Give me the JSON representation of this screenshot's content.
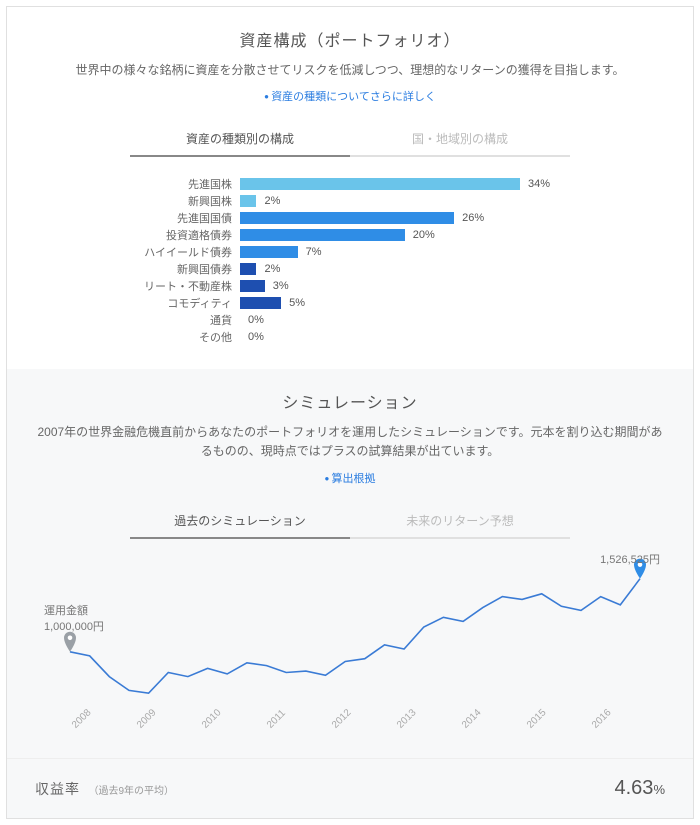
{
  "portfolio": {
    "title": "資産構成（ポートフォリオ）",
    "desc": "世界中の様々な銘柄に資産を分散させてリスクを低減しつつ、理想的なリターンの獲得を目指します。",
    "link": "資産の種類についてさらに詳しく",
    "tab_active": "資産の種類別の構成",
    "tab_inactive": "国・地域別の構成"
  },
  "chart_data": {
    "type": "bar",
    "categories": [
      "先進国株",
      "新興国株",
      "先進国国債",
      "投資適格債券",
      "ハイイールド債券",
      "新興国債券",
      "リート・不動産株",
      "コモディティ",
      "通貨",
      "その他"
    ],
    "values": [
      34,
      2,
      26,
      20,
      7,
      2,
      3,
      5,
      0,
      0
    ],
    "colors": [
      "#6ac4ea",
      "#6ac4ea",
      "#2f8de6",
      "#2f8de6",
      "#2f8de6",
      "#1e4fb0",
      "#1e4fb0",
      "#1e4fb0",
      "#1e4fb0",
      "#1e4fb0"
    ],
    "max": 34,
    "ylabel": "%"
  },
  "sim": {
    "title": "シミュレーション",
    "desc": "2007年の世界金融危機直前からあなたのポートフォリオを運用したシミュレーションです。元本を割り込む期間があるものの、現時点ではプラスの試算結果が出ています。",
    "link": "算出根拠",
    "tab_active": "過去のシミュレーション",
    "tab_inactive": "未来のリターン予想",
    "start_label": "運用金額",
    "start_value": "1,000,000円",
    "end_value": "1,526,525円"
  },
  "line_data": {
    "type": "line",
    "x_ticks": [
      "2008",
      "2009",
      "2010",
      "2011",
      "2012",
      "2013",
      "2014",
      "2015",
      "2016"
    ],
    "start": 1000000,
    "end": 1526525,
    "series_norm": [
      1.0,
      0.97,
      0.82,
      0.72,
      0.7,
      0.85,
      0.82,
      0.88,
      0.84,
      0.92,
      0.9,
      0.85,
      0.86,
      0.83,
      0.93,
      0.95,
      1.05,
      1.02,
      1.18,
      1.25,
      1.22,
      1.32,
      1.4,
      1.38,
      1.42,
      1.33,
      1.3,
      1.4,
      1.34,
      1.53
    ]
  },
  "ret": {
    "label": "収益率",
    "sub": "（過去9年の平均）",
    "value": "4.63",
    "pct": "%"
  }
}
